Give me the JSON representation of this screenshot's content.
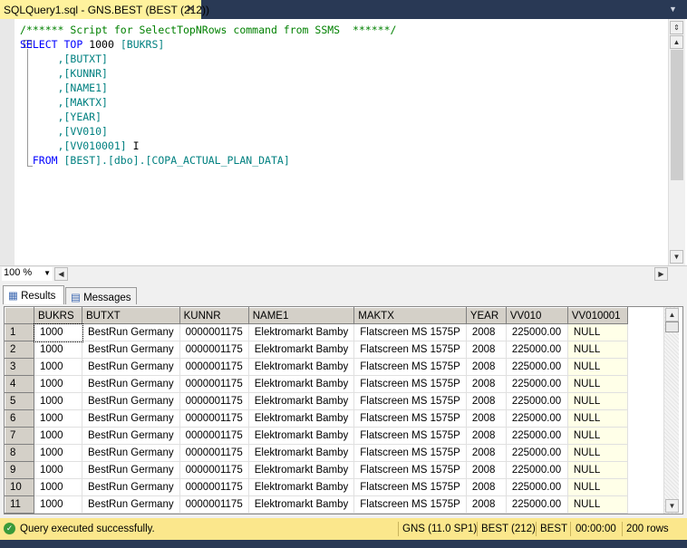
{
  "tab": {
    "title": "SQLQuery1.sql - GNS.BEST (BEST (212))",
    "close": "✕"
  },
  "code": {
    "comment": "/****** Script for SelectTopNRows command from SSMS  ******/",
    "select_kw": "SELECT",
    "top_kw": "TOP",
    "top_n": "1000",
    "first_col": "[BUKRS]",
    "cols": [
      ",[BUTXT]",
      ",[KUNNR]",
      ",[NAME1]",
      ",[MAKTX]",
      ",[YEAR]",
      ",[VV010]",
      ",[VV010001]"
    ],
    "from_kw": "FROM",
    "from_table": "[BEST].[dbo].[COPA_ACTUAL_PLAN_DATA]"
  },
  "zoom": {
    "value": "100 %"
  },
  "results_tabs": [
    {
      "label": "Results"
    },
    {
      "label": "Messages"
    }
  ],
  "grid": {
    "columns": [
      "BUKRS",
      "BUTXT",
      "KUNNR",
      "NAME1",
      "MAKTX",
      "YEAR",
      "VV010",
      "VV010001"
    ],
    "rows": [
      [
        "1",
        "1000",
        "BestRun Germany",
        "0000001175",
        "Elektromarkt Bamby",
        "Flatscreen MS 1575P",
        "2008",
        "225000.00",
        "NULL"
      ],
      [
        "2",
        "1000",
        "BestRun Germany",
        "0000001175",
        "Elektromarkt Bamby",
        "Flatscreen MS 1575P",
        "2008",
        "225000.00",
        "NULL"
      ],
      [
        "3",
        "1000",
        "BestRun Germany",
        "0000001175",
        "Elektromarkt Bamby",
        "Flatscreen MS 1575P",
        "2008",
        "225000.00",
        "NULL"
      ],
      [
        "4",
        "1000",
        "BestRun Germany",
        "0000001175",
        "Elektromarkt Bamby",
        "Flatscreen MS 1575P",
        "2008",
        "225000.00",
        "NULL"
      ],
      [
        "5",
        "1000",
        "BestRun Germany",
        "0000001175",
        "Elektromarkt Bamby",
        "Flatscreen MS 1575P",
        "2008",
        "225000.00",
        "NULL"
      ],
      [
        "6",
        "1000",
        "BestRun Germany",
        "0000001175",
        "Elektromarkt Bamby",
        "Flatscreen MS 1575P",
        "2008",
        "225000.00",
        "NULL"
      ],
      [
        "7",
        "1000",
        "BestRun Germany",
        "0000001175",
        "Elektromarkt Bamby",
        "Flatscreen MS 1575P",
        "2008",
        "225000.00",
        "NULL"
      ],
      [
        "8",
        "1000",
        "BestRun Germany",
        "0000001175",
        "Elektromarkt Bamby",
        "Flatscreen MS 1575P",
        "2008",
        "225000.00",
        "NULL"
      ],
      [
        "9",
        "1000",
        "BestRun Germany",
        "0000001175",
        "Elektromarkt Bamby",
        "Flatscreen MS 1575P",
        "2008",
        "225000.00",
        "NULL"
      ],
      [
        "10",
        "1000",
        "BestRun Germany",
        "0000001175",
        "Elektromarkt Bamby",
        "Flatscreen MS 1575P",
        "2008",
        "225000.00",
        "NULL"
      ],
      [
        "11",
        "1000",
        "BestRun Germany",
        "0000001175",
        "Elektromarkt Bamby",
        "Flatscreen MS 1575P",
        "2008",
        "225000.00",
        "NULL"
      ]
    ]
  },
  "status": {
    "message": "Query executed successfully.",
    "server": "GNS (11.0 SP1)",
    "user": "BEST (212)",
    "database": "BEST",
    "elapsed": "00:00:00",
    "rows": "200 rows"
  }
}
